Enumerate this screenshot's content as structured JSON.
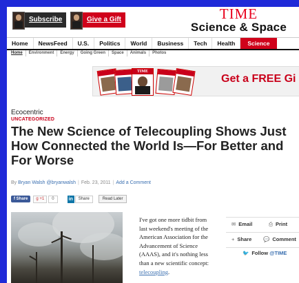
{
  "header": {
    "subscribe_label": "Subscribe",
    "gift_label": "Give a Gift",
    "brand_top": "TIME",
    "brand_sub": "Science & Space"
  },
  "nav": {
    "items": [
      "Home",
      "NewsFeed",
      "U.S.",
      "Politics",
      "World",
      "Business",
      "Tech",
      "Health",
      "Science"
    ],
    "active": "Science"
  },
  "subnav": {
    "items": [
      "Home",
      "Environment",
      "Energy",
      "Going Green",
      "Space",
      "Animals",
      "Photos"
    ]
  },
  "ad": {
    "text": "Get a FREE Gi",
    "cover_title": "TIME"
  },
  "article": {
    "blog": "Ecocentric",
    "category": "UNCATEGORIZED",
    "headline": "The New Science of Telecoupling Shows Just How Connected the World Is—For Better and For Worse",
    "by": "By",
    "author": "Bryan Walsh",
    "handle": "@bryanwalsh",
    "date": "Feb. 23, 2011",
    "comment_link": "Add a Comment",
    "body_text": "I've got one more tidbit from last weekend's meeting of the American Association for the Advancement of Science (AAAS), and it's nothing less than a new scientific concept:",
    "body_link": "telecoupling",
    "body_end": "."
  },
  "share": {
    "fb_label": "f Share",
    "gplus_label": "g +1",
    "gplus_count": "0",
    "linkedin_label": "in",
    "linkedin_share": "Share",
    "read_later": "Read Later"
  },
  "tools": {
    "email": "Email",
    "print": "Print",
    "share": "Share",
    "comment": "Comment",
    "follow": "Follow",
    "follow_handle": "@TIME"
  },
  "colors": {
    "frame_blue": "#1f2ad8",
    "time_red": "#e8001c",
    "nav_active": "#d0021b",
    "link_blue": "#3a6fb0"
  }
}
